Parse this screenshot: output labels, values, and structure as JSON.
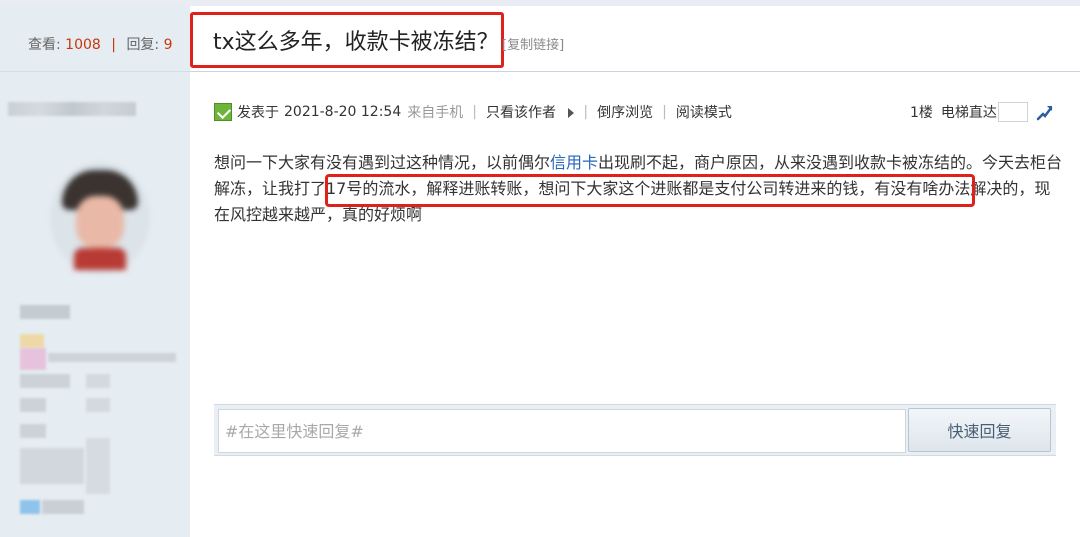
{
  "stats": {
    "views_label": "查看:",
    "views": "1008",
    "sep": "|",
    "replies_label": "回复:",
    "replies": "9"
  },
  "thread": {
    "title": "tx这么多年，收款卡被冻结？",
    "copy_link": "[复制链接]"
  },
  "post": {
    "posted_label": "发表于",
    "datetime": "2021-8-20 12:54",
    "source": "来自手机",
    "only_author": "只看该作者",
    "reverse": "倒序浏览",
    "read_mode": "阅读模式",
    "floor": "1楼",
    "elevator": "电梯直达",
    "body_part1": "想问一下大家有没有遇到过这种情况，以前偶尔",
    "body_link": "信用卡",
    "body_part2": "出现刷不起，商户原因，从来没遇到收款卡被冻结的。今天去柜台解冻，让我打了17号的流水，解释进账转账，想问下大家这个进账都是支付公司转进来的钱，有没有啥办法解决的，现在风控越来越严，真的好烦啊"
  },
  "reply": {
    "placeholder": "#在这里快速回复#",
    "button": "快速回复"
  },
  "colors": {
    "accent_red": "#e0201a",
    "link_blue": "#2366b8",
    "count_red": "#c6370c",
    "sidebar_bg": "#e5edf2"
  },
  "icons": {
    "post": "post-icon",
    "jump": "jump-icon",
    "arrow": "triangle-right-icon"
  }
}
